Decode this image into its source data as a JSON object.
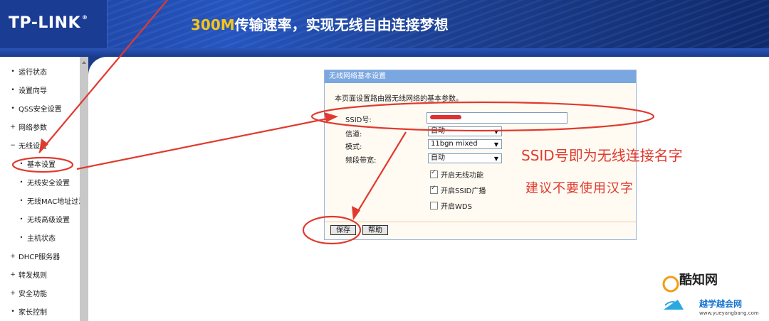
{
  "header": {
    "brand": "TP-LINK",
    "brand_mark": "®",
    "slogan_num": "300M",
    "slogan_text": "传输速率，实现无线自由连接梦想"
  },
  "sidebar": {
    "items": [
      {
        "label": "运行状态",
        "level": 1
      },
      {
        "label": "设置向导",
        "level": 1
      },
      {
        "label": "QSS安全设置",
        "level": 1
      },
      {
        "label": "网络参数",
        "level": 1,
        "bullet": "+"
      },
      {
        "label": "无线设置",
        "level": 1,
        "bullet": "−"
      },
      {
        "label": "基本设置",
        "level": 2,
        "active": true
      },
      {
        "label": "无线安全设置",
        "level": 2
      },
      {
        "label": "无线MAC地址过滤",
        "level": 2
      },
      {
        "label": "无线高级设置",
        "level": 2
      },
      {
        "label": "主机状态",
        "level": 2
      },
      {
        "label": "DHCP服务器",
        "level": 1,
        "bullet": "+"
      },
      {
        "label": "转发规则",
        "level": 1,
        "bullet": "+"
      },
      {
        "label": "安全功能",
        "level": 1,
        "bullet": "+"
      },
      {
        "label": "家长控制",
        "level": 1
      }
    ]
  },
  "panel": {
    "title": "无线网络基本设置",
    "description": "本页面设置路由器无线网络的基本参数。",
    "fields": {
      "ssid_label": "SSID号:",
      "channel_label": "信道:",
      "channel_value": "自动",
      "mode_label": "模式:",
      "mode_value": "11bgn mixed",
      "bandwidth_label": "频段带宽:",
      "bandwidth_value": "自动"
    },
    "checkboxes": [
      {
        "label": "开启无线功能",
        "checked": true
      },
      {
        "label": "开启SSID广播",
        "checked": true
      },
      {
        "label": "开启WDS",
        "checked": false
      }
    ],
    "buttons": {
      "save": "保存",
      "help": "帮助"
    }
  },
  "annotations": {
    "note1": "SSID号即为无线连接名字",
    "note2": "建议不要使用汉字",
    "color": "#e03a2f"
  },
  "watermark": {
    "line1": "酷知网",
    "line2": "越学越会网",
    "line3": "www.yueyangbang.com"
  }
}
